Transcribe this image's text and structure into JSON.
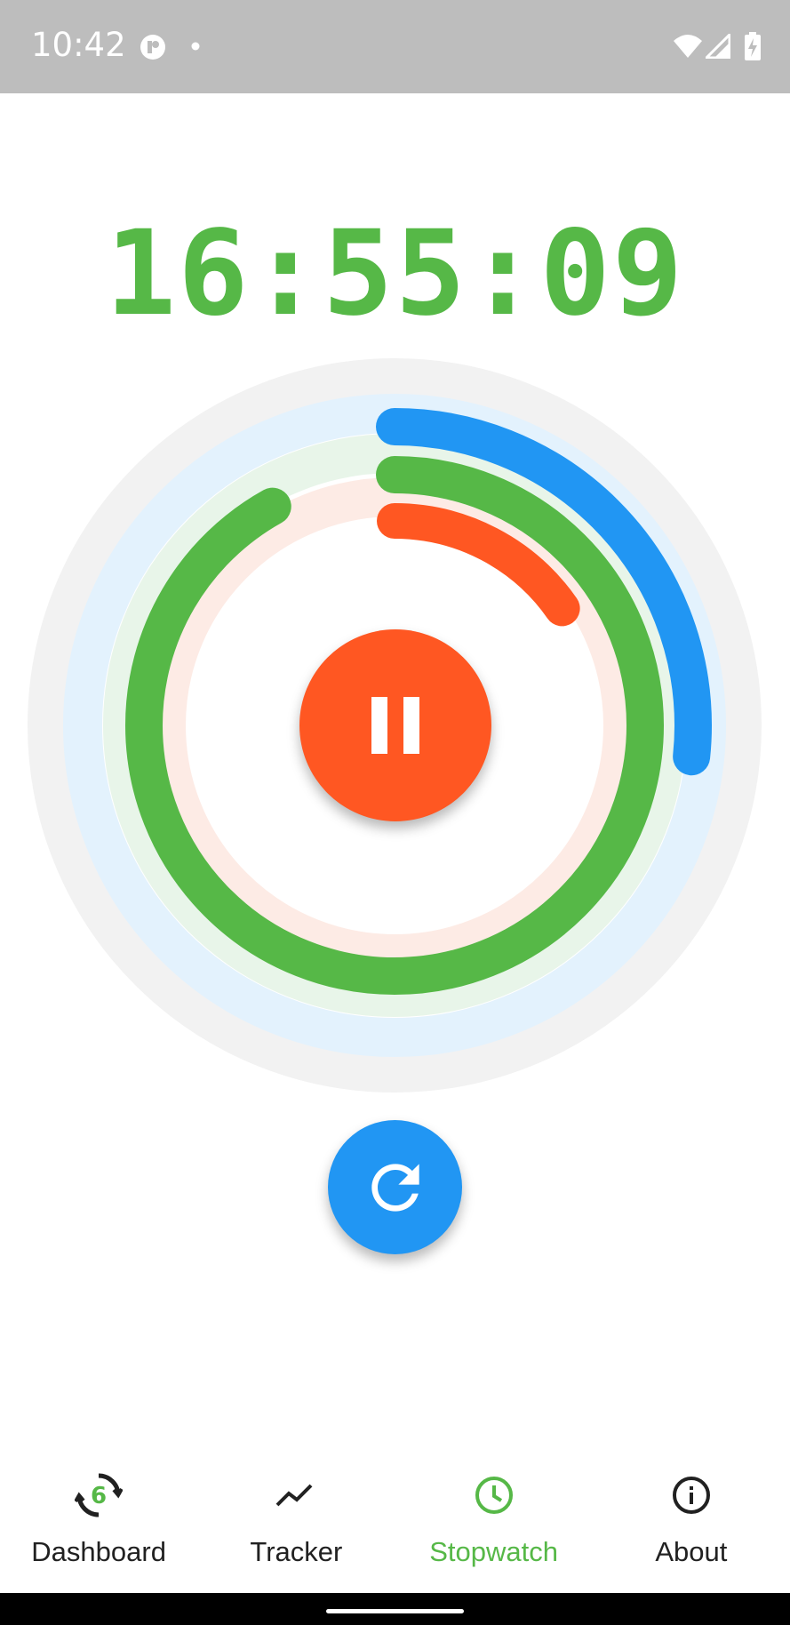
{
  "status_bar": {
    "time": "10:42",
    "icons": [
      "notification-app-icon",
      "dot-icon",
      "wifi-icon",
      "signal-icon",
      "battery-charging-icon"
    ]
  },
  "stopwatch": {
    "time_display": "16:55:09",
    "colors": {
      "timer": "#56b847",
      "hours_ring": "#2196f3",
      "minutes_ring": "#56b847",
      "seconds_ring": "#ff5722",
      "pause_button": "#ff5722",
      "reset_button": "#2196f3"
    },
    "rings": {
      "hours_progress": 0.2667,
      "minutes_progress": 0.919,
      "seconds_progress": 0.153
    },
    "pause_icon": "pause-icon",
    "reset_icon": "refresh-icon"
  },
  "bottom_nav": {
    "items": [
      {
        "label": "Dashboard",
        "icon": "dashboard-icon",
        "active": false
      },
      {
        "label": "Tracker",
        "icon": "trending-up-icon",
        "active": false
      },
      {
        "label": "Stopwatch",
        "icon": "clock-icon",
        "active": true
      },
      {
        "label": "About",
        "icon": "info-icon",
        "active": false
      }
    ],
    "active_color": "#56b847",
    "inactive_color": "#212121"
  }
}
